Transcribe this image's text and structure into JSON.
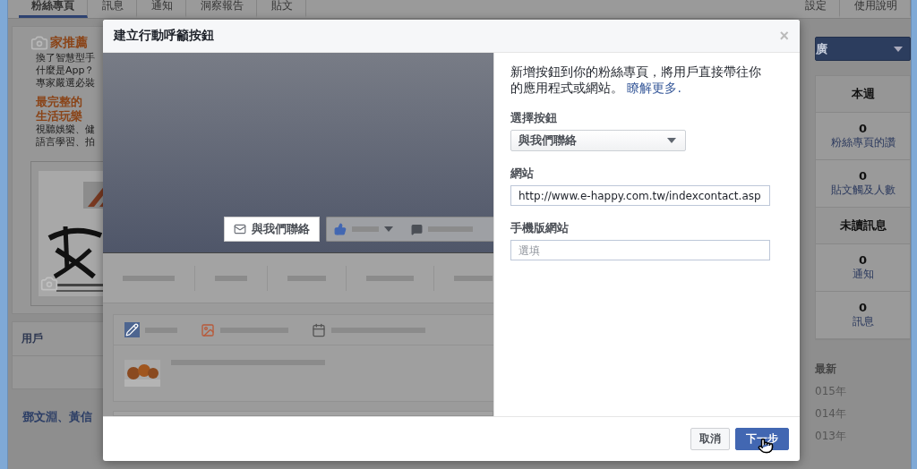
{
  "page": {
    "tabs": [
      {
        "label": "粉絲專頁",
        "selected": true
      },
      {
        "label": "訊息",
        "selected": false
      },
      {
        "label": "通知",
        "selected": false
      },
      {
        "label": "洞察報告",
        "selected": false
      },
      {
        "label": "貼文",
        "selected": false
      }
    ],
    "right_tabs": [
      {
        "label": "設定",
        "selected": false
      },
      {
        "label": "使用說明",
        "selected": false
      }
    ],
    "promo": {
      "title": "家推薦",
      "lines": [
        "換了智慧型手",
        "什麼是App？",
        "專家嚴選必裝"
      ],
      "headline": [
        "最完整的",
        "生活玩樂"
      ],
      "body": [
        "視聽娛樂、健",
        "語言學習、拍"
      ]
    },
    "section_title": "用戶",
    "authors": "鄧文淵、黃信",
    "promote_button": "廣",
    "stat_groups": [
      {
        "title": "本週",
        "stats": [
          {
            "value": "0",
            "label": "粉絲專頁的讚"
          },
          {
            "value": "0",
            "label": "貼文觸及人數"
          }
        ]
      },
      {
        "title": "未讀訊息",
        "stats": [
          {
            "value": "0",
            "label": "通知"
          },
          {
            "value": "0",
            "label": "訊息"
          }
        ]
      }
    ],
    "latest": {
      "title": "最新",
      "years": [
        "015年",
        "014年",
        "013年"
      ]
    }
  },
  "dialog": {
    "title": "建立行動呼籲按鈕",
    "close_symbol": "×",
    "preview": {
      "cta_button": "與我們聯絡"
    },
    "description": "新增按鈕到你的粉絲專頁，將用戶直接帶往你的應用程式或網站。",
    "learn_more": "瞭解更多.",
    "fields": [
      {
        "kind": "select",
        "label": "選擇按鈕",
        "value": "與我們聯絡"
      },
      {
        "kind": "text",
        "label": "網站",
        "value": "http://www.e-happy.com.tw/indexcontact.asp"
      },
      {
        "kind": "text",
        "label": "手機版網站",
        "placeholder": "選填"
      }
    ],
    "buttons": [
      {
        "kind": "secondary",
        "label": "取消"
      },
      {
        "kind": "primary",
        "label": "下一步"
      }
    ]
  }
}
